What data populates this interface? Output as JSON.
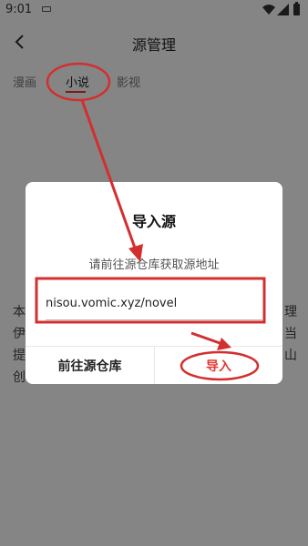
{
  "status_bar": {
    "time": "9:01"
  },
  "header": {
    "title": "源管理"
  },
  "tabs": [
    {
      "label": "漫画"
    },
    {
      "label": "小说"
    },
    {
      "label": "影视"
    }
  ],
  "background_fragments": [
    "本",
    "伊",
    "提",
    "创",
    "理",
    "当",
    "山"
  ],
  "dialog": {
    "title": "导入源",
    "subtitle": "请前往源仓库获取源地址",
    "input_value": "nisou.vomic.xyz/novel",
    "goto_label": "前往源仓库",
    "import_label": "导入"
  },
  "colors": {
    "accent": "#e53935",
    "annotation": "#d32f2f"
  }
}
